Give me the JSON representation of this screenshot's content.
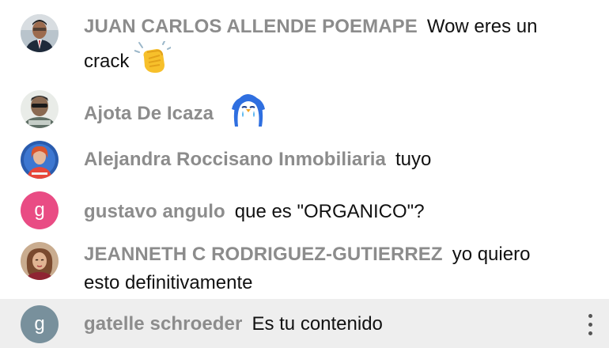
{
  "messages": [
    {
      "author": "JUAN CARLOS ALLENDE POEMAPE",
      "text": "Wow eres un crack",
      "emoji": "clapping-hands"
    },
    {
      "author": "Ajota De Icaza",
      "text": "",
      "emoji": "crying-penguin"
    },
    {
      "author": "Alejandra Roccisano Inmobiliaria",
      "text": "tuyo"
    },
    {
      "author": "gustavo angulo",
      "text": "que es \"ORGANICO\"?",
      "avatar_letter": "g",
      "avatar_color": "#e94c84"
    },
    {
      "author": "JEANNETH C RODRIGUEZ-GUTIERREZ",
      "text": "yo quiero esto definitivamente"
    },
    {
      "author": "gatelle schroeder",
      "text": "Es tu contenido",
      "avatar_letter": "g",
      "avatar_color": "#78909c"
    }
  ],
  "colors": {
    "author": "#8c8c8c",
    "text": "#111111",
    "highlight_row": "#eeeeee"
  },
  "icons": {
    "more": "more-vert-icon"
  }
}
